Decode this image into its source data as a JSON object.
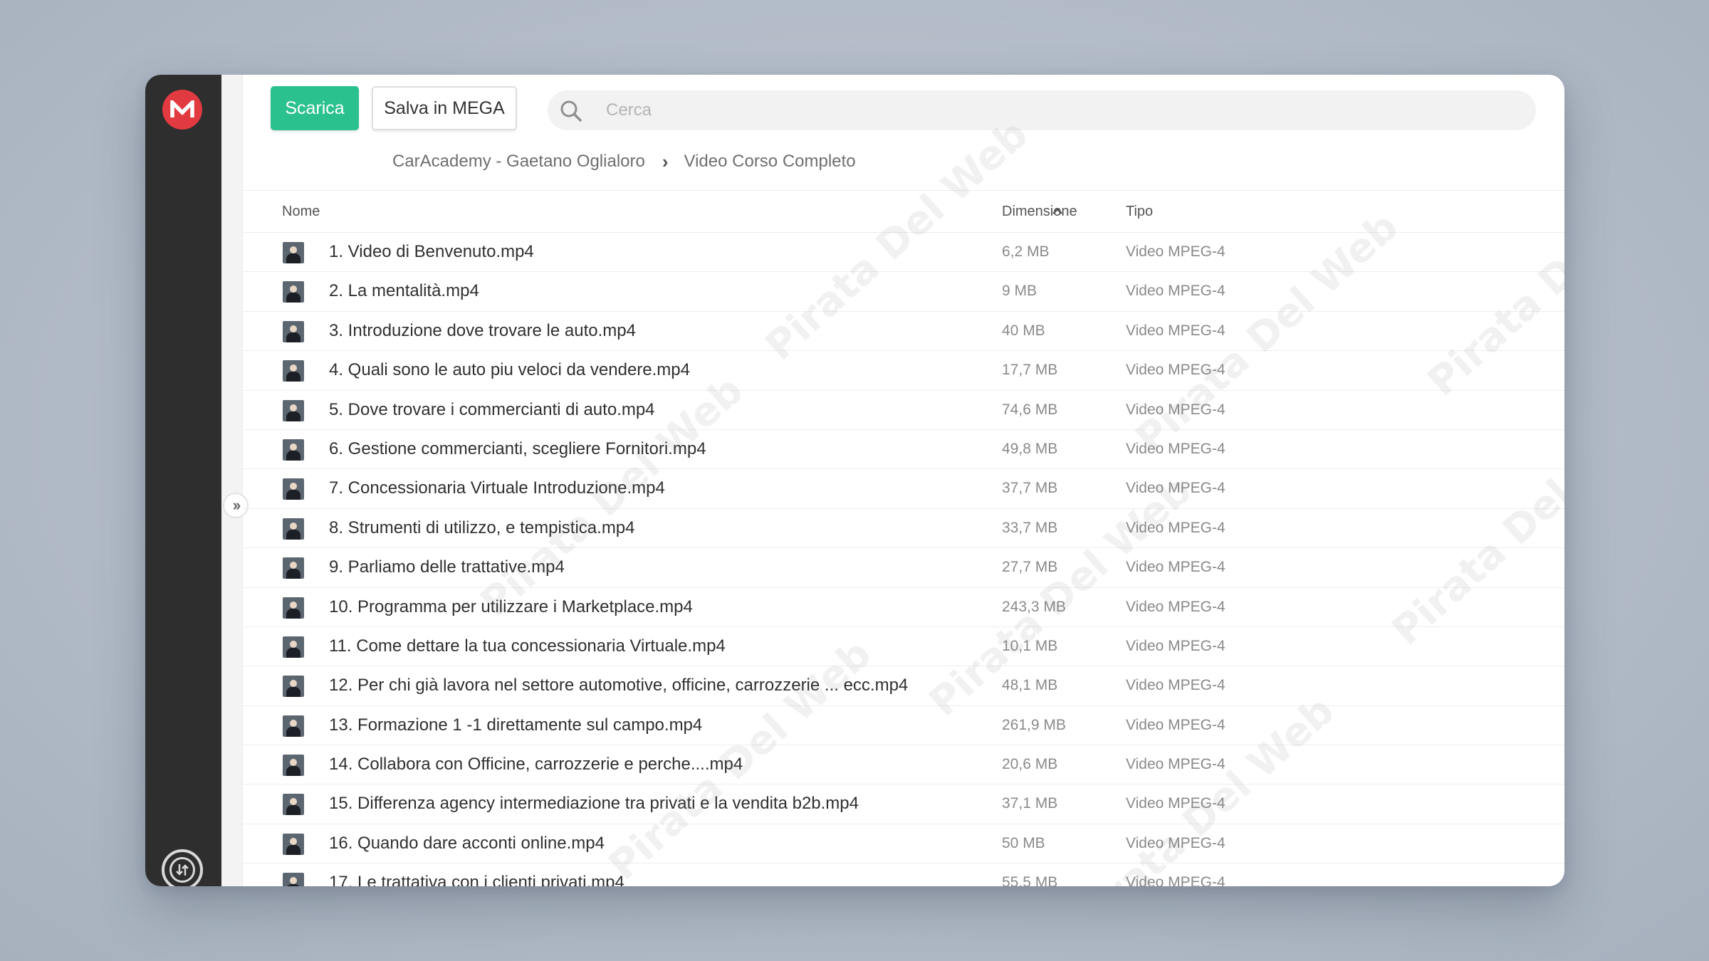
{
  "toolbar": {
    "download_label": "Scarica",
    "save_label": "Salva in MEGA"
  },
  "search": {
    "placeholder": "Cerca",
    "value": ""
  },
  "breadcrumb": {
    "items": [
      "CarAcademy - Gaetano Oglialoro",
      "Video Corso Completo"
    ],
    "separator": "›"
  },
  "list": {
    "columns": {
      "name": "Nome",
      "size": "Dimensione",
      "type": "Tipo"
    },
    "sort": {
      "column": "Nome",
      "direction": "ascending"
    },
    "files": [
      {
        "name": "1. Video di Benvenuto.mp4",
        "size": "6,2 MB",
        "type": "Video MPEG-4"
      },
      {
        "name": "2. La mentalità.mp4",
        "size": "9 MB",
        "type": "Video MPEG-4"
      },
      {
        "name": "3. Introduzione dove trovare le auto.mp4",
        "size": "40 MB",
        "type": "Video MPEG-4"
      },
      {
        "name": "4. Quali sono le auto piu veloci da vendere.mp4",
        "size": "17,7 MB",
        "type": "Video MPEG-4"
      },
      {
        "name": "5. Dove trovare i commercianti di auto.mp4",
        "size": "74,6 MB",
        "type": "Video MPEG-4"
      },
      {
        "name": "6. Gestione commercianti, scegliere Fornitori.mp4",
        "size": "49,8 MB",
        "type": "Video MPEG-4"
      },
      {
        "name": "7. Concessionaria Virtuale Introduzione.mp4",
        "size": "37,7 MB",
        "type": "Video MPEG-4"
      },
      {
        "name": "8. Strumenti di utilizzo, e tempistica.mp4",
        "size": "33,7 MB",
        "type": "Video MPEG-4"
      },
      {
        "name": "9. Parliamo delle trattative.mp4",
        "size": "27,7 MB",
        "type": "Video MPEG-4"
      },
      {
        "name": "10. Programma per utilizzare i Marketplace.mp4",
        "size": "243,3 MB",
        "type": "Video MPEG-4"
      },
      {
        "name": "11. Come dettare la tua concessionaria Virtuale.mp4",
        "size": "10,1 MB",
        "type": "Video MPEG-4"
      },
      {
        "name": "12. Per chi già lavora nel settore automotive, officine, carrozzerie ... ecc.mp4",
        "size": "48,1 MB",
        "type": "Video MPEG-4"
      },
      {
        "name": "13. Formazione 1 -1 direttamente sul campo.mp4",
        "size": "261,9 MB",
        "type": "Video MPEG-4"
      },
      {
        "name": "14. Collabora con Officine, carrozzerie e perche....mp4",
        "size": "20,6 MB",
        "type": "Video MPEG-4"
      },
      {
        "name": "15. Differenza agency intermediazione tra privati e la vendita b2b.mp4",
        "size": "37,1 MB",
        "type": "Video MPEG-4"
      },
      {
        "name": "16. Quando dare acconti online.mp4",
        "size": "50 MB",
        "type": "Video MPEG-4"
      },
      {
        "name": "17. Le trattativa con i clienti privati.mp4",
        "size": "55,5 MB",
        "type": "Video MPEG-4"
      }
    ]
  },
  "icons": {
    "logo": "mega-logo",
    "search": "search-icon",
    "expand": "double-chevron-right-icon",
    "sort": "chevron-up-icon",
    "bottom": "transfer-icon",
    "file": "video-thumbnail"
  },
  "colors": {
    "accent": "#2bc18f",
    "brand": "#e23a41",
    "sidebar": "#2e2e2e"
  },
  "watermark_text": "Pirata Del Web"
}
